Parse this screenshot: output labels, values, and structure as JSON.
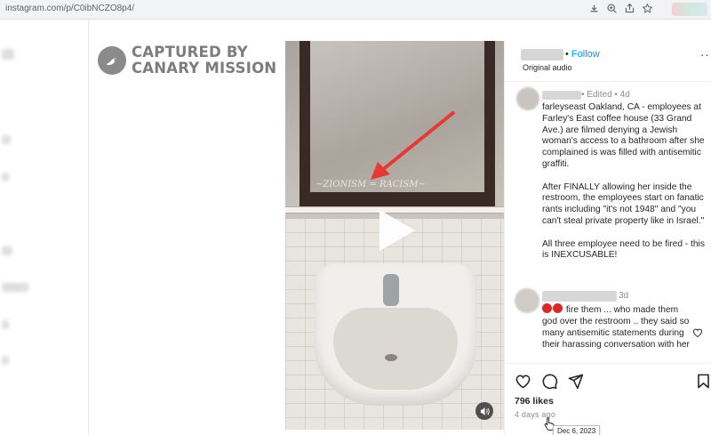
{
  "browser": {
    "url": "instagram.com/p/C0ibNCZO8p4/",
    "toolbar_icons": [
      "download-icon",
      "zoom-icon",
      "share-icon",
      "star-icon"
    ]
  },
  "watermark": {
    "line1": "CAPTURED BY",
    "line2": "CANARY MISSION"
  },
  "video": {
    "graffiti": "~ZIONISM = RACISM~",
    "state": "paused"
  },
  "post": {
    "follow_label": "Follow",
    "separator": "•",
    "audio_label": "Original audio",
    "caption_meta": "• Edited • 4d",
    "caption_paragraphs": [
      "farleyseast Oakland, CA - employees at Farley's East coffee house (33 Grand Ave.) are filmed denying a Jewish woman's access to a bathroom after she complained is was filled with antisemitic graffiti.",
      "After FINALLY allowing her inside the restroom, the employees start on fanatic rants including \"it's not 1948\" and \"you can't steal private property like in Israel.\"",
      "All three employee need to be fired - this is INEXCUSABLE!"
    ],
    "comment": {
      "time": "3d",
      "text": "fire them ... who made them god over the restroom .. they said so many antisemitic statements during their harassing conversation with her"
    },
    "likes": "796 likes",
    "time_ago": "4 days ago",
    "tooltip_date": "Dec 6, 2023"
  },
  "colors": {
    "link": "#0095f6",
    "muted": "#8e8e8e",
    "text": "#262626"
  }
}
